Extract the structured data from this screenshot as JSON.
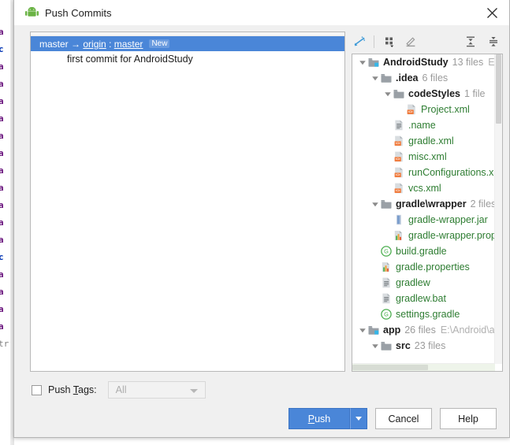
{
  "window": {
    "title": "Push Commits",
    "app_icon": "android-robot-icon",
    "close_icon": "close-icon"
  },
  "background_editor": {
    "lines": [
      "a",
      "c",
      "a",
      "a",
      "a",
      "a",
      "a",
      "a",
      "a",
      "a",
      "a",
      "a",
      "a",
      "c",
      "a",
      "a",
      "a",
      "a",
      "tr"
    ]
  },
  "commits": {
    "header": {
      "local_branch": "master",
      "arrow": "→",
      "remote": "origin",
      "separator": " : ",
      "remote_branch": "master",
      "badge": "New"
    },
    "messages": [
      {
        "text": "first commit for AndroidStudy"
      }
    ]
  },
  "toolbar": {
    "buttons": [
      {
        "name": "show-diff-icon",
        "title": "Show Diff"
      },
      {
        "name": "group-by-icon",
        "title": "Group By"
      },
      {
        "name": "edit-icon",
        "title": "Edit Source"
      },
      {
        "name": "expand-all-icon",
        "title": "Expand All"
      },
      {
        "name": "collapse-all-icon",
        "title": "Collapse All"
      }
    ]
  },
  "tree": {
    "rows": [
      {
        "indent": 0,
        "twisty": "down",
        "icon": "module-folder-icon",
        "name": "AndroidStudy",
        "bold": true,
        "type": "dir",
        "meta": "13 files",
        "path": "E:\\Ar"
      },
      {
        "indent": 1,
        "twisty": "down",
        "icon": "folder-icon",
        "name": ".idea",
        "bold": true,
        "type": "dir",
        "meta": "6 files",
        "path": ""
      },
      {
        "indent": 2,
        "twisty": "down",
        "icon": "folder-icon",
        "name": "codeStyles",
        "bold": true,
        "type": "dir",
        "meta": "1 file",
        "path": ""
      },
      {
        "indent": 3,
        "twisty": "none",
        "icon": "xml-file-icon",
        "name": "Project.xml",
        "bold": false,
        "type": "file",
        "meta": "",
        "path": ""
      },
      {
        "indent": 2,
        "twisty": "none",
        "icon": "text-file-icon",
        "name": ".name",
        "bold": false,
        "type": "file",
        "meta": "",
        "path": ""
      },
      {
        "indent": 2,
        "twisty": "none",
        "icon": "xml-file-icon",
        "name": "gradle.xml",
        "bold": false,
        "type": "file",
        "meta": "",
        "path": ""
      },
      {
        "indent": 2,
        "twisty": "none",
        "icon": "xml-file-icon",
        "name": "misc.xml",
        "bold": false,
        "type": "file",
        "meta": "",
        "path": ""
      },
      {
        "indent": 2,
        "twisty": "none",
        "icon": "xml-file-icon",
        "name": "runConfigurations.xm",
        "bold": false,
        "type": "file",
        "meta": "",
        "path": ""
      },
      {
        "indent": 2,
        "twisty": "none",
        "icon": "xml-file-icon",
        "name": "vcs.xml",
        "bold": false,
        "type": "file",
        "meta": "",
        "path": ""
      },
      {
        "indent": 1,
        "twisty": "down",
        "icon": "folder-icon",
        "name": "gradle\\wrapper",
        "bold": true,
        "type": "dir",
        "meta": "2 files",
        "path": ""
      },
      {
        "indent": 2,
        "twisty": "none",
        "icon": "jar-file-icon",
        "name": "gradle-wrapper.jar",
        "bold": false,
        "type": "file",
        "meta": "",
        "path": ""
      },
      {
        "indent": 2,
        "twisty": "none",
        "icon": "properties-file-icon",
        "name": "gradle-wrapper.prop",
        "bold": false,
        "type": "file",
        "meta": "",
        "path": ""
      },
      {
        "indent": 1,
        "twisty": "none",
        "icon": "gradle-file-icon",
        "name": "build.gradle",
        "bold": false,
        "type": "file",
        "meta": "",
        "path": ""
      },
      {
        "indent": 1,
        "twisty": "none",
        "icon": "properties-file-icon",
        "name": "gradle.properties",
        "bold": false,
        "type": "file",
        "meta": "",
        "path": ""
      },
      {
        "indent": 1,
        "twisty": "none",
        "icon": "text-file-icon",
        "name": "gradlew",
        "bold": false,
        "type": "file",
        "meta": "",
        "path": ""
      },
      {
        "indent": 1,
        "twisty": "none",
        "icon": "text-file-icon",
        "name": "gradlew.bat",
        "bold": false,
        "type": "file",
        "meta": "",
        "path": ""
      },
      {
        "indent": 1,
        "twisty": "none",
        "icon": "gradle-file-icon",
        "name": "settings.gradle",
        "bold": false,
        "type": "file",
        "meta": "",
        "path": ""
      },
      {
        "indent": 0,
        "twisty": "down",
        "icon": "module-folder-icon",
        "name": "app",
        "bold": true,
        "type": "dir",
        "meta": "26 files",
        "path": "E:\\Android\\ap"
      },
      {
        "indent": 1,
        "twisty": "down",
        "icon": "folder-icon",
        "name": "src",
        "bold": true,
        "type": "dir",
        "meta": "23 files",
        "path": ""
      }
    ]
  },
  "push_tags": {
    "checked": false,
    "label_prefix": "Push ",
    "label_mnemonic": "T",
    "label_suffix": "ags:",
    "select_value": "All",
    "select_enabled": false,
    "dropdown_icon": "chevron-down-icon"
  },
  "footer": {
    "push_mnemonic": "P",
    "push_rest": "ush",
    "push_dropdown_icon": "chevron-down-icon",
    "cancel_label": "Cancel",
    "help_label": "Help"
  },
  "colors": {
    "accent_blue": "#4a86d8",
    "file_green": "#2e7d32",
    "meta_gray": "#9b9b9b",
    "dialog_bg": "#f0f0f0"
  }
}
